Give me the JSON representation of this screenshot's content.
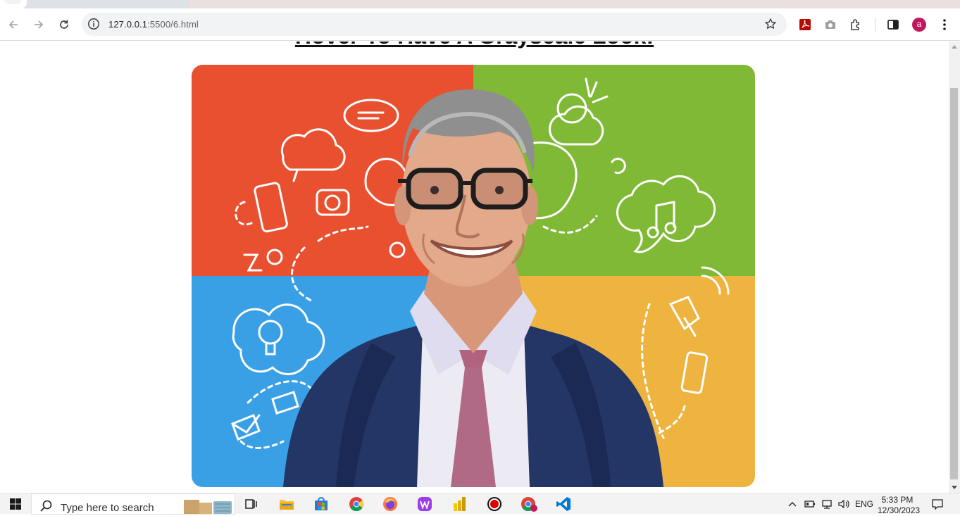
{
  "browser": {
    "url_host": "127.0.0.1",
    "url_path": ":5500/6.html",
    "profile_initial": "a"
  },
  "page": {
    "heading": "Hover To Have A Grayscale Look!",
    "image": {
      "description_name": "hero-image",
      "colors": {
        "top_left": "#e8502f",
        "top_right": "#7fb935",
        "bottom_left": "#3aa0e6",
        "bottom_right": "#efb340"
      }
    }
  },
  "taskbar": {
    "search_placeholder": "Type here to search",
    "language": "ENG",
    "time": "5:33 PM",
    "date": "12/30/2023"
  }
}
